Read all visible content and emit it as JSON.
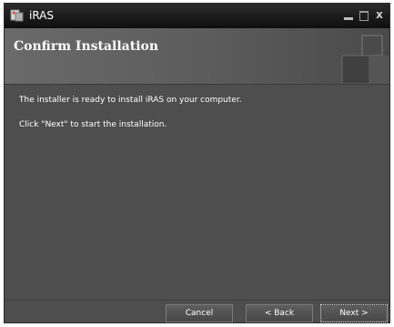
{
  "window": {
    "title": "iRAS",
    "icon": "iras-app-icon",
    "controls": {
      "minimize": "minimize-icon",
      "maximize": "maximize-icon",
      "close_label": "x"
    }
  },
  "header": {
    "title": "Confirm Installation"
  },
  "body": {
    "line1": "The installer is ready to install iRAS on your computer.",
    "line2": "Click \"Next\" to start the installation."
  },
  "buttons": {
    "cancel": "Cancel",
    "back": "< Back",
    "next": "Next >"
  },
  "colors": {
    "window_bg": "#4e4e4e",
    "titlebar_bg": "#111111",
    "text": "#ffffff"
  }
}
